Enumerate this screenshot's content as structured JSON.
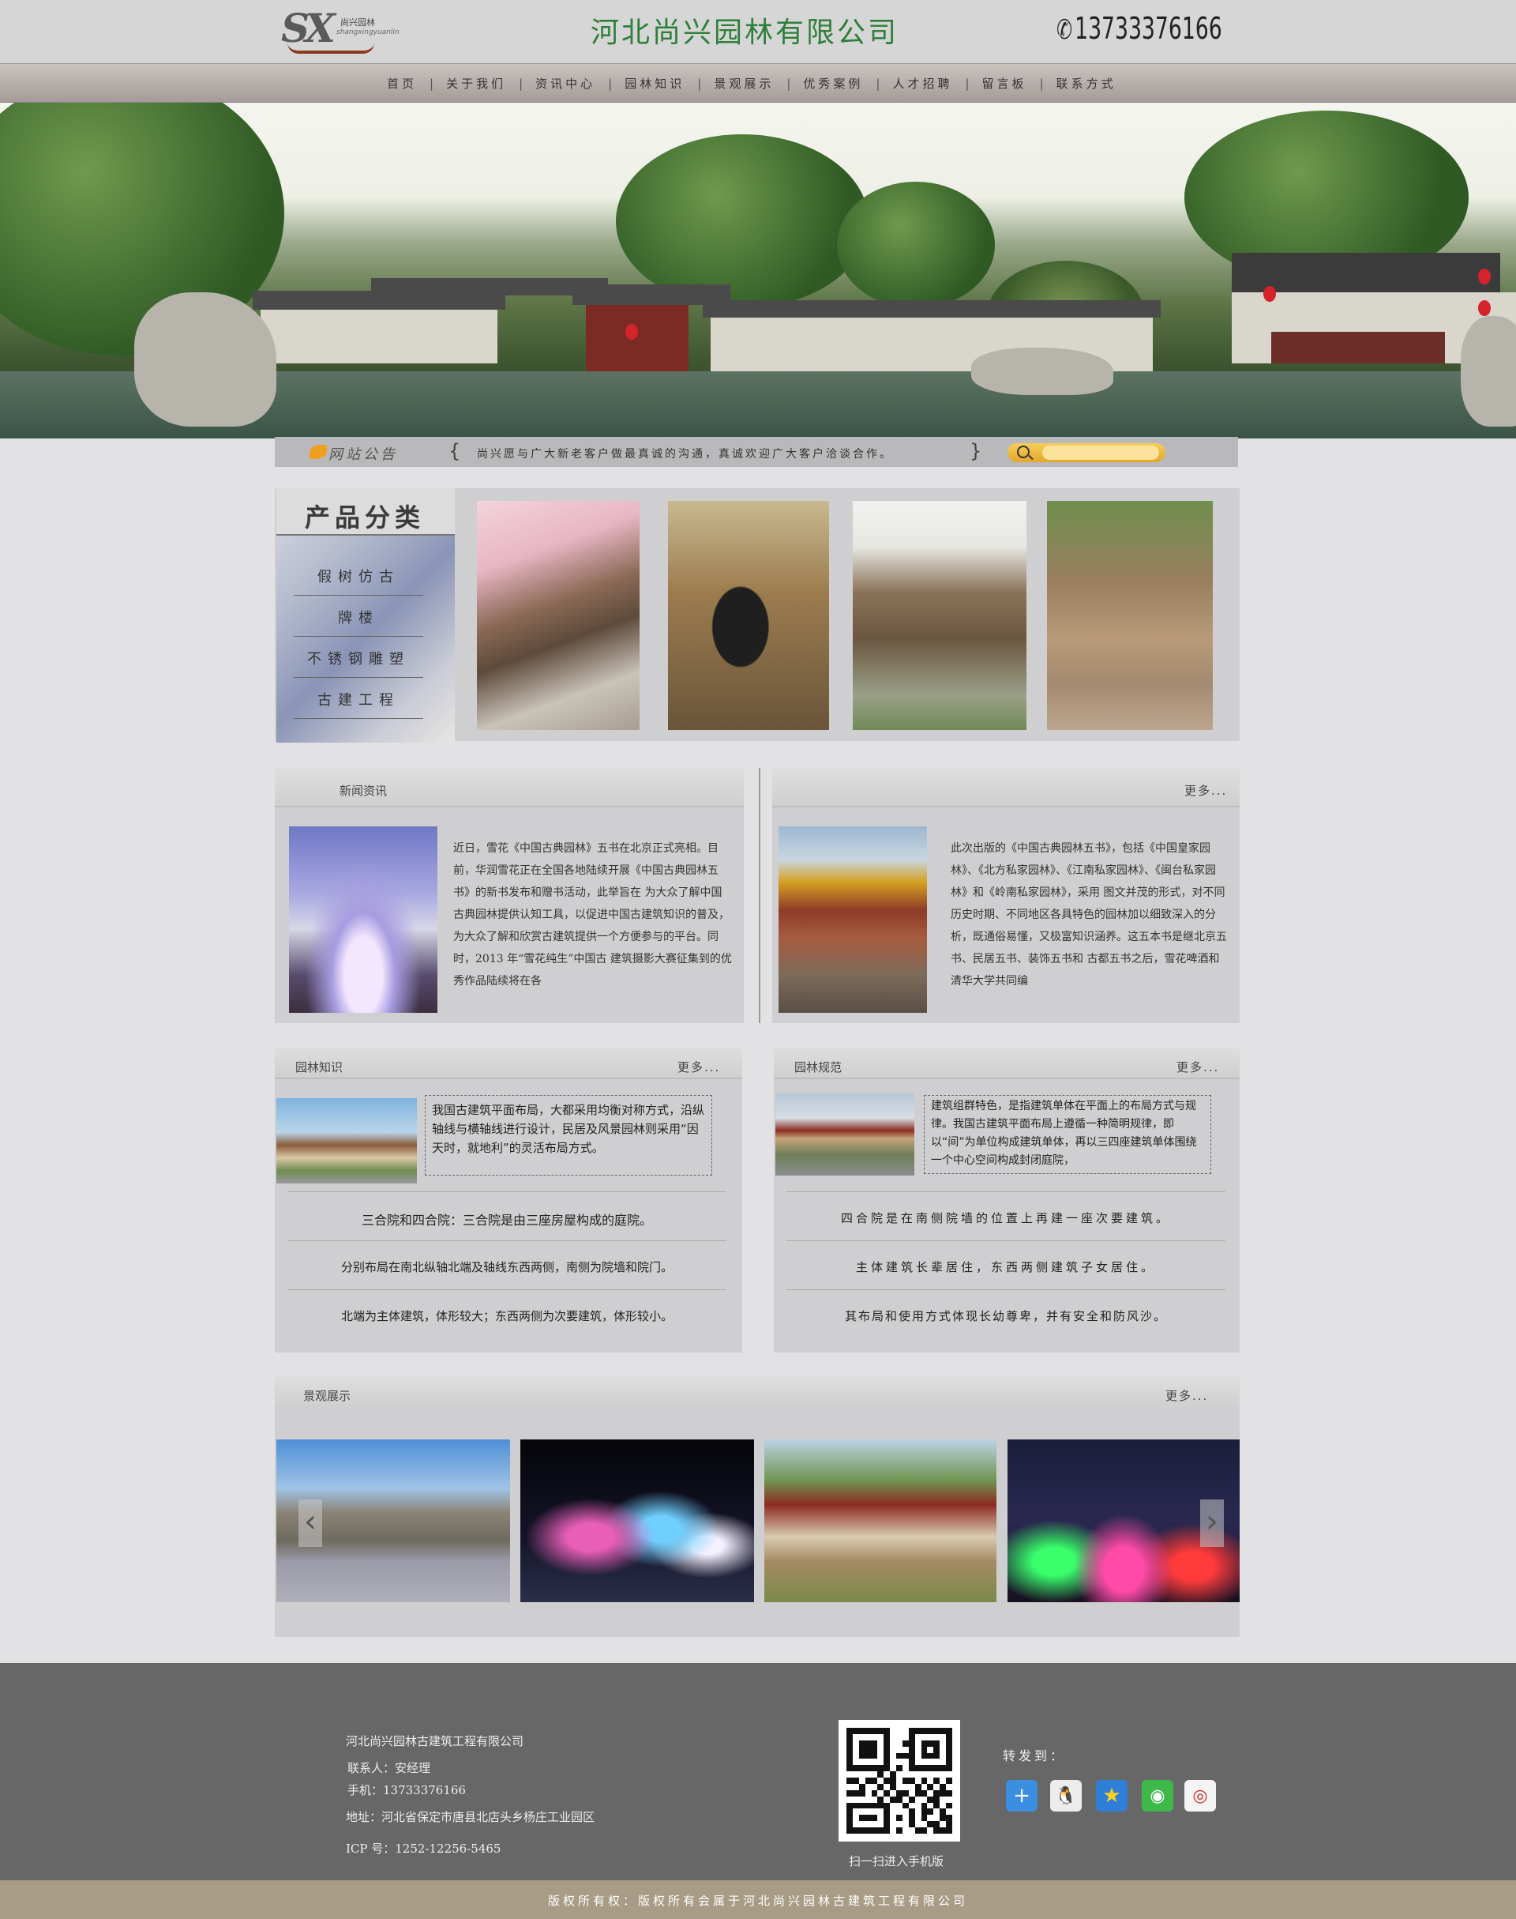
{
  "header": {
    "logo_text": "SX",
    "logo_cn": "尚兴园林",
    "logo_en": "shangxingyuanlin",
    "company": "河北尚兴园林有限公司",
    "phone": "13733376166"
  },
  "nav": [
    "首页",
    "关于我们",
    "资讯中心",
    "园林知识",
    "景观展示",
    "优秀案例",
    "人才招聘",
    "留言板",
    "联系方式"
  ],
  "notice": {
    "label": "网站公告",
    "brace_open": "{",
    "brace_close": "}",
    "text": "尚兴愿与广大新老客户做最真诚的沟通，真诚欢迎广大客户洽谈合作。",
    "search_placeholder": ""
  },
  "products": {
    "title": "产品分类",
    "categories": [
      "假树仿古",
      "牌楼",
      "不锈钢雕塑",
      "古建工程"
    ]
  },
  "news": {
    "title": "新闻资讯",
    "text": "近日，雪花《中国古典园林》五书在北京正式亮相。目前，华润雪花正在全国各地陆续开展《中国古典园林五书》的新书发布和赠书活动，此举旨在 为大众了解中国古典园林提供认知工具，以促进中国古建筑知识的普及，为大众了解和欣赏古建筑提供一个方便参与的平台。同时，2013 年“雪花纯生”中国古 建筑摄影大赛征集到的优秀作品陆续将在各"
  },
  "news2": {
    "more": "更多...",
    "text": "此次出版的《中国古典园林五书》，包括《中国皇家园林》、《北方私家园林》、《江南私家园林》、《闽台私家园林》和《岭南私家园林》，采用 图文并茂的形式，对不同历史时期、不同地区各具特色的园林加以细致深入的分析，既通俗易懂，又极富知识涵养。这五本书是继北京五书、民居五书、装饰五书和 古都五书之后，雪花啤酒和清华大学共同编"
  },
  "knowledge": {
    "title": "园林知识",
    "more": "更多...",
    "summary": "我国古建筑平面布局，大都采用均衡对称方式，沿纵轴线与横轴线进行设计，民居及风景园林则采用“因天时，就地利”的灵活布局方式。",
    "items": [
      "三合院和四合院：三合院是由三座房屋构成的庭院。",
      "分别布局在南北纵轴北端及轴线东西两侧，南侧为院墙和院门。",
      "北端为主体建筑，体形较大；东西两侧为次要建筑，体形较小。"
    ]
  },
  "standards": {
    "title": "园林规范",
    "more": "更多...",
    "summary": "建筑组群特色，是指建筑单体在平面上的布局方式与规律。我国古建筑平面布局上遵循一种简明规律，即以“间”为单位构成建筑单体，再以三四座建筑单体围绕一个中心空间构成封闭庭院，",
    "items": [
      "四合院是在南侧院墙的位置上再建一座次要建筑。",
      "主体建筑长辈居住，东西两侧建筑子女居住。",
      "其布局和使用方式体现长幼尊卑，并有安全和防风沙。"
    ]
  },
  "gallery": {
    "title": "景观展示",
    "more": "更多...",
    "prev_arrow": "‹",
    "next_arrow": "›"
  },
  "footer": {
    "company": "河北尚兴园林古建筑工程有限公司",
    "contact": "联系人：安经理",
    "mobile": "手机：13733376166",
    "address": "地址：河北省保定市唐县北店头乡杨庄工业园区",
    "icp": "ICP 号：1252-12256-5465",
    "qr_caption": "扫一扫进入手机版",
    "share_label": "转发到：",
    "share_icons": [
      "plus-icon",
      "qq-icon",
      "qzone-star-icon",
      "wechat-icon",
      "weibo-icon"
    ]
  },
  "copyright": "版权所有权：版权所有会属于河北尚兴园林古建筑工程有限公司",
  "colors": {
    "title_green": "#2e7f3a",
    "footer_bg": "#676767",
    "copyright_bg": "#a89c86"
  }
}
